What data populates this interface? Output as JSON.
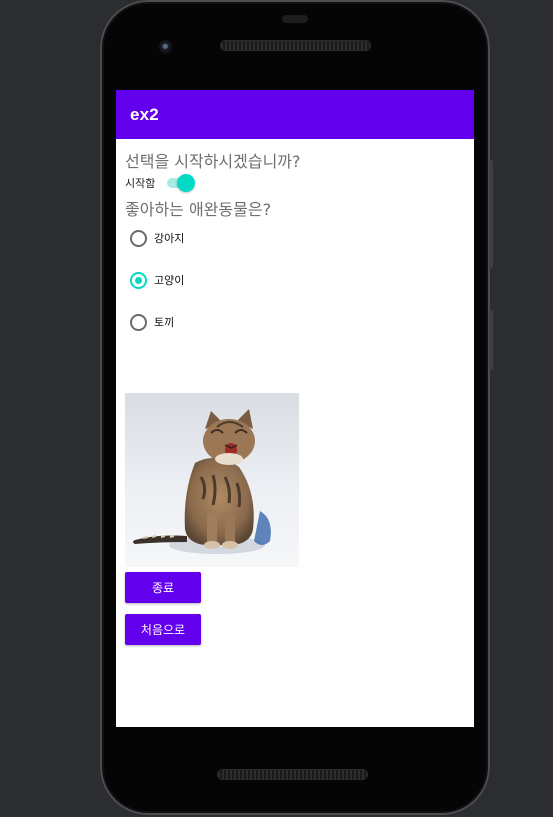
{
  "app": {
    "title": "ex2"
  },
  "question1": {
    "text": "선택을 시작하시겠습니까?"
  },
  "start_switch": {
    "label": "시작함",
    "checked": true
  },
  "question2": {
    "text": "좋아하는 애완동물은?"
  },
  "pets": {
    "options": [
      {
        "label": "강아지",
        "checked": false
      },
      {
        "label": "고양이",
        "checked": true
      },
      {
        "label": "토끼",
        "checked": false
      }
    ],
    "image": "cat-photo"
  },
  "buttons": {
    "finish_label": "종료",
    "restart_label": "처음으로"
  },
  "colors": {
    "primary": "#6200ee",
    "accent": "#03dac5"
  }
}
